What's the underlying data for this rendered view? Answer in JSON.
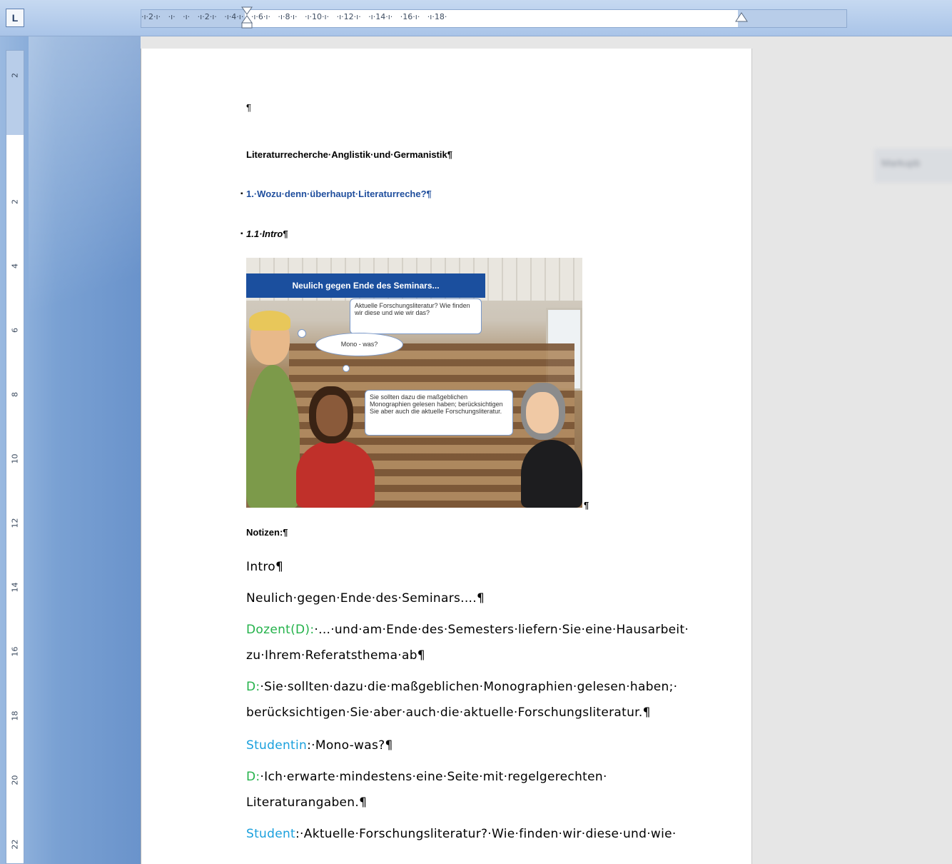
{
  "ruler": {
    "tab_selector": "L",
    "horizontal_labels": "·ı·2·ı·   ·ı·   ·ı·   ·ı·2·ı·   ·ı·4·ı·   ·ı·6·ı·   ·ı·8·ı·   ·ı·10·ı·   ·ı·12·ı·   ·ı·14·ı·   ·16·ı·   ·ı·18·",
    "vertical_labels": [
      "2",
      "2",
      "4",
      "6",
      "8",
      "10",
      "12",
      "14",
      "16",
      "18",
      "20",
      "22"
    ]
  },
  "markup_pane": {
    "label": "Markupb"
  },
  "document": {
    "empty_para": "¶",
    "title": "Literaturrecherche·Anglistik·und·Germanistik¶",
    "heading1": "1.·Wozu·denn·überhaupt·Literaturreche?¶",
    "heading2": "1.1·Intro¶",
    "image_pilcrow": "¶",
    "notes_label": "Notizen:¶",
    "intro": "Intro¶",
    "neulich": "Neulich·gegen·Ende·des·Seminars....¶",
    "line1_speaker": "Dozent(D):",
    "line1_text": "·...·und·am·Ende·des·Semesters·liefern·Sie·eine·Hausarbeit·",
    "line1_cont": "zu·Ihrem·Referatsthema·ab¶",
    "line2_speaker": "D:",
    "line2_text": "·Sie·sollten·dazu·die·maßgeblichen·Monographien·gelesen·haben;·",
    "line2_cont": "berücksichtigen·Sie·aber·auch·die·aktuelle·Forschungsliteratur.¶",
    "line3_speaker": "Studentin",
    "line3_text": ":·Mono-was?¶",
    "line4_speaker": "D:",
    "line4_text": "·Ich·erwarte·mindestens·eine·Seite·mit·regelgerechten·",
    "line4_cont": "Literaturangaben.¶",
    "line5_speaker": "Student",
    "line5_text": ":·Aktuelle·Forschungsliteratur?·Wie·finden·wir·diese·und·wie·"
  },
  "slide": {
    "banner": "Neulich gegen Ende des Seminars...",
    "bubble_student": "Aktuelle Forschungsliteratur? Wie finden wir diese und wie wir das?",
    "thought_studentin": "Mono - was?",
    "bubble_dozent": "Sie sollten dazu die maßgeblichen Monographien gelesen haben; berücksichtigen Sie aber auch die aktuelle Forschungsliteratur."
  },
  "colors": {
    "heading_blue": "#1f4e9d",
    "speaker_green": "#23b24a",
    "speaker_cyan": "#1aa0dd",
    "banner_blue": "#1b4f9e",
    "chrome_blue": "#7aa1d3"
  }
}
